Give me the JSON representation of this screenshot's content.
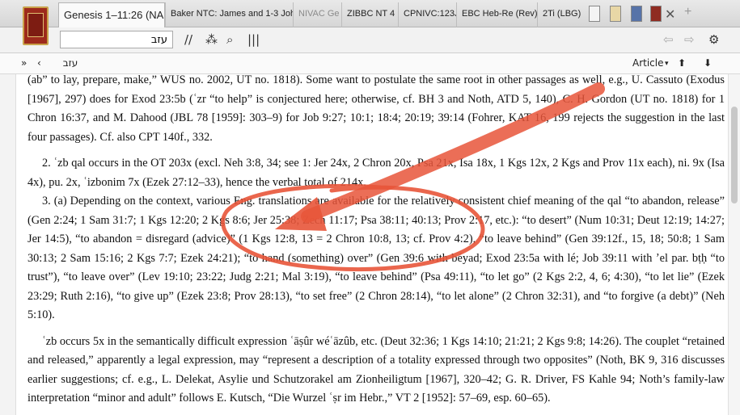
{
  "tabs": {
    "active": "Genesis 1–11:26 (NAC)",
    "items": [
      "Baker NTC: James and 1-3 John",
      "NIVAC Ge",
      "ZIBBC NT 4",
      "CPNIVC:123J",
      "EBC Heb-Re (Rev)",
      "2Ti (LBG)"
    ]
  },
  "toolbar": {
    "search_value": "עזב"
  },
  "subbar": {
    "reference": "עזב",
    "article_label": "Article"
  },
  "content": {
    "lines": [
      "(ab” to lay, prepare, make,” WUS no. 2002, UT no. 1818). Some want to postulate the same root in other passages as well, e.g., U. Cassuto",
      "(Exodus [1967], 297) does for Exod 23:5b (ʿzr “to help” is conjectured here; otherwise, cf. BH 3 and Noth, ATD 5, 140), C. H. Gordon (UT no.",
      "1818) for 1 Chron 16:37, and M. Dahood (JBL 78 [1959]: 303–9) for Job 9:27; 10:1; 18:4; 20:19; 39:14 (Fohrer, KAT 16, 199 rejects the suggestion",
      "in the last four passages). Cf. also CPT 140f., 332.",
      "2. ʿzb qal occurs in the OT 203x (excl. Neh 3:8, 34; see 1: Jer 24x, 2 Chron 20x, Psa 21x, Isa 18x, 1 Kgs 12x, 2 Kgs and Prov 11x",
      "each), ni. 9x (Isa 4x), pu. 2x, ʿizbonim 7x (Ezek 27:12–33), hence the verbal total of 214x.",
      "3. (a) Depending on the context, various Eng. translations are available for the relatively consistent chief meaning of the qal",
      "“to abandon, release” (Gen 2:24; 1 Sam 31:7; 1 Kgs 12:20; 2 Kgs 8:6; Jer 25:38; Zech 11:17; Psa 38:11; 40:13; Prov 2:17, etc.): “to",
      "desert” (Num 10:31; Deut 12:19; 14:27; Jer 14:5), “to abandon = disregard (advice)” (1 Kgs 12:8, 13 = 2 Chron 10:8, 13; cf. Prov 4:2),",
      "“to leave behind” (Gen 39:12f., 15, 18; 50:8; 1 Sam 30:13; 2 Sam 15:16; 2 Kgs 7:7; Ezek 24:21); “to hand (something) over” (Gen 39:6",
      "with béyad; Exod 23:5a with lé; Job 39:11 with ʼel par. bṭḥ “to trust”), “to leave over” (Lev 19:10; 23:22; Judg 2:21; Mal 3:19), “to",
      "leave behind” (Psa 49:11), “to let go” (2 Kgs 2:2, 4, 6; 4:30), “to let lie” (Ezek 23:29; Ruth 2:16), “to give up” (Ezek 23:8; Prov 28:13),",
      "“to set free” (2 Chron 28:14), “to let alone” (2 Chron 32:31), and “to forgive (a debt)” (Neh 5:10).",
      "ʿzb occurs 5x in the semantically difficult expression ʿāṣûr wéʿāzûb, etc. (Deut 32:36; 1 Kgs 14:10; 21:21; 2 Kgs 9:8; 14:26). The",
      "couplet “retained and released,” apparently a legal expression, may “represent a description of a totality expressed through two",
      "opposites” (Noth, BK 9, 316 discusses earlier suggestions; cf. e.g., L. Delekat, Asylie und Schutzorakel am Zionheiligtum [1967],",
      "320–42; G. R. Driver, FS Kahle 94; Noth’s family-law interpretation “minor and adult” follows E. Kutsch, “Die Wurzel ʿṣr im Hebr.,”",
      "VT 2 [1952]: 57–69, esp. 60–65)."
    ]
  },
  "colors": {
    "annotation": "#e8553a",
    "link": "#1a3e9a"
  }
}
